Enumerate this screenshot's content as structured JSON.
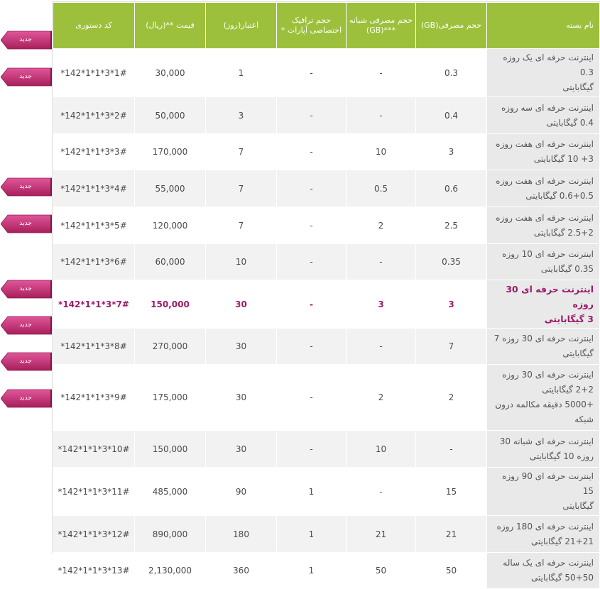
{
  "headers": [
    "نام بسته",
    "حجم مصرفی(GB)",
    "حجم مصرفی شبانه ***(GB)",
    "حجم ترافیک اختصاصی آپارات *",
    "اعتبار(روز)",
    "قیمت **(ریال)",
    "کد دستوری"
  ],
  "badge_label": "جدید",
  "colors": {
    "header_bg": "#9cc03b",
    "highlight_text": "#9b1b69",
    "badge": "#c4306e"
  },
  "rows": [
    {
      "name": [
        "اینترنت حرفه ای یک روزه 0.3",
        "گیگابایتی"
      ],
      "volume": "0.3",
      "night": "-",
      "aparat": "-",
      "days": "1",
      "price": "30,000",
      "code": "*142*1*1*3*1#",
      "highlight": false
    },
    {
      "name": [
        "اینترنت حرفه ای سه روزه",
        "0.4 گیگابایتی"
      ],
      "volume": "0.4",
      "night": "-",
      "aparat": "-",
      "days": "3",
      "price": "50,000",
      "code": "*142*1*1*3*2#",
      "highlight": false
    },
    {
      "name": [
        "اینترنت حرفه ای هفت روزه",
        "3+ 10 گیگابایتی"
      ],
      "volume": "3",
      "night": "10",
      "aparat": "-",
      "days": "7",
      "price": "170,000",
      "code": "*142*1*1*3*3#",
      "highlight": false
    },
    {
      "name": [
        "اینترنت حرفه ای هفت روزه",
        "0.6+0.5 گیگابایتی"
      ],
      "volume": "0.6",
      "night": "0.5",
      "aparat": "-",
      "days": "7",
      "price": "55,000",
      "code": "*142*1*1*3*4#",
      "highlight": false
    },
    {
      "name": [
        "اینترنت حرفه ای هفت روزه",
        "2.5+2 گیگابایتی"
      ],
      "volume": "2.5",
      "night": "2",
      "aparat": "-",
      "days": "7",
      "price": "120,000",
      "code": "*142*1*1*3*5#",
      "highlight": false
    },
    {
      "name": [
        "اینترنت حرفه ای 10 روزه",
        "0.35 گیگابایتی"
      ],
      "volume": "0.35",
      "night": "-",
      "aparat": "-",
      "days": "10",
      "price": "60,000",
      "code": "*142*1*1*3*6#",
      "highlight": false
    },
    {
      "name": [
        "اینترنت حرفه ای 30 روزه",
        "3 گیگابایتی"
      ],
      "volume": "3",
      "night": "3",
      "aparat": "-",
      "days": "30",
      "price": "150,000",
      "code": "*142*1*1*3*7#",
      "highlight": true
    },
    {
      "name": [
        "اینترنت حرفه ای 30 روزه 7",
        "گیگابایتی"
      ],
      "volume": "7",
      "night": "-",
      "aparat": "-",
      "days": "30",
      "price": "270,000",
      "code": "*142*1*1*3*8#",
      "highlight": false
    },
    {
      "name": [
        "اینترنت حرفه ای 30 روزه",
        "2+2 گیگابایتی",
        "+5000 دقیقه مکالمه درون",
        "شبکه"
      ],
      "volume": "2",
      "night": "2",
      "aparat": "-",
      "days": "30",
      "price": "175,000",
      "code": "*142*1*1*3*9#",
      "highlight": false
    },
    {
      "name": [
        "اینترنت حرفه ای شبانه 30",
        "روزه 10 گیگابایتی"
      ],
      "volume": "-",
      "night": "10",
      "aparat": "-",
      "days": "30",
      "price": "150,000",
      "code": "*142*1*1*3*10#",
      "highlight": false
    },
    {
      "name": [
        "اینترنت حرفه ای 90 روزه 15",
        "گیگابایتی"
      ],
      "volume": "15",
      "night": "-",
      "aparat": "1",
      "days": "90",
      "price": "485,000",
      "code": "*142*1*1*3*11#",
      "highlight": false
    },
    {
      "name": [
        "اینترنت حرفه ای 180 روزه",
        "21+21 گیگابایتی"
      ],
      "volume": "21",
      "night": "21",
      "aparat": "1",
      "days": "180",
      "price": "890,000",
      "code": "*142*1*1*3*12#",
      "highlight": false
    },
    {
      "name": [
        "اینترنت حرفه ای یک ساله",
        "50+50 گیگابایتی"
      ],
      "volume": "50",
      "night": "50",
      "aparat": "1",
      "days": "360",
      "price": "2,130,000",
      "code": "*142*1*1*3*13#",
      "highlight": false
    }
  ]
}
